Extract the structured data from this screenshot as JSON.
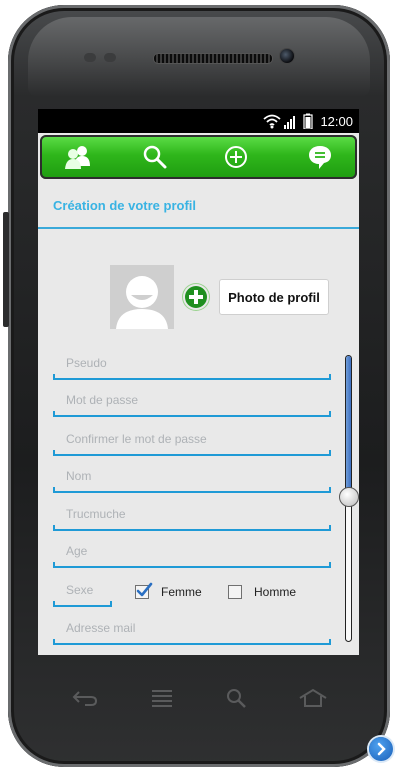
{
  "status_bar": {
    "time": "12:00"
  },
  "action_bar": {
    "icons": [
      "people-icon",
      "search-icon",
      "add-circle-icon",
      "chat-bubble-icon"
    ]
  },
  "page": {
    "title": "Création de votre profil"
  },
  "profile_photo": {
    "button_label": "Photo de profil",
    "add_icon": "plus-icon",
    "avatar_icon": "avatar-icon"
  },
  "form": {
    "pseudo_placeholder": "Pseudo",
    "password_placeholder": "Mot de passe",
    "confirm_password_placeholder": "Confirmer le mot de passe",
    "name_placeholder": "Nom",
    "trucmuche_placeholder": "Trucmuche",
    "age_placeholder": "Age",
    "sex_placeholder": "Sexe",
    "female_label": "Femme",
    "female_checked": true,
    "male_label": "Homme",
    "male_checked": false,
    "email_placeholder": "Adresse mail"
  },
  "scroll": {
    "position_fraction": 0.49
  },
  "colors": {
    "accent_blue": "#39b3e3",
    "action_bar_green": "#2fb61b",
    "field_underline": "#1f9ad6"
  }
}
